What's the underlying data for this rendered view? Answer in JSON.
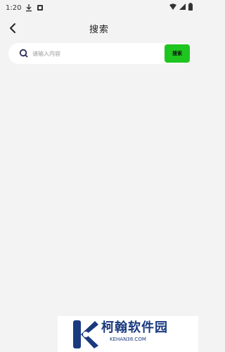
{
  "status_bar": {
    "time": "1:20",
    "icons": [
      "download-icon",
      "notification-icon",
      "wifi-icon",
      "signal-icon",
      "battery-icon"
    ]
  },
  "header": {
    "title": "搜索",
    "back_icon": "chevron-left-icon"
  },
  "search": {
    "placeholder": "请输入内容",
    "value": "",
    "button_label": "搜索",
    "icon": "search-icon"
  },
  "colors": {
    "background": "#f3f3f3",
    "accent": "#1fc51f",
    "watermark_blue": "#1a3a80"
  },
  "watermark": {
    "name": "柯翰软件园",
    "url": "KEHAN38.COM"
  }
}
